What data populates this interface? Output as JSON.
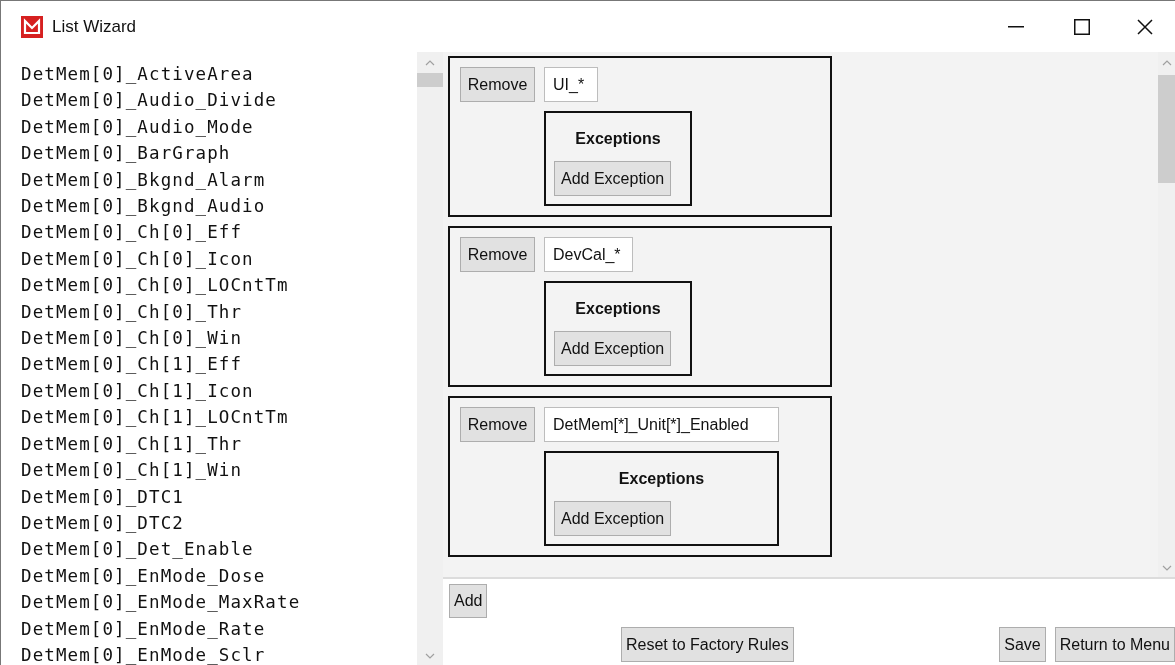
{
  "window": {
    "title": "List Wizard"
  },
  "variables": [
    "DetMem[0]_ActiveArea",
    "DetMem[0]_Audio_Divide",
    "DetMem[0]_Audio_Mode",
    "DetMem[0]_BarGraph",
    "DetMem[0]_Bkgnd_Alarm",
    "DetMem[0]_Bkgnd_Audio",
    "DetMem[0]_Ch[0]_Eff",
    "DetMem[0]_Ch[0]_Icon",
    "DetMem[0]_Ch[0]_LOCntTm",
    "DetMem[0]_Ch[0]_Thr",
    "DetMem[0]_Ch[0]_Win",
    "DetMem[0]_Ch[1]_Eff",
    "DetMem[0]_Ch[1]_Icon",
    "DetMem[0]_Ch[1]_LOCntTm",
    "DetMem[0]_Ch[1]_Thr",
    "DetMem[0]_Ch[1]_Win",
    "DetMem[0]_DTC1",
    "DetMem[0]_DTC2",
    "DetMem[0]_Det_Enable",
    "DetMem[0]_EnMode_Dose",
    "DetMem[0]_EnMode_MaxRate",
    "DetMem[0]_EnMode_Rate",
    "DetMem[0]_EnMode_Sclr"
  ],
  "rules": [
    {
      "remove_label": "Remove",
      "pattern": "UI_*",
      "exceptions_title": "Exceptions",
      "add_exception_label": "Add Exception"
    },
    {
      "remove_label": "Remove",
      "pattern": "DevCal_*",
      "exceptions_title": "Exceptions",
      "add_exception_label": "Add Exception"
    },
    {
      "remove_label": "Remove",
      "pattern": "DetMem[*]_Unit[*]_Enabled",
      "exceptions_title": "Exceptions",
      "add_exception_label": "Add Exception"
    }
  ],
  "add_label": "Add",
  "buttons": {
    "reset": "Reset to Factory Rules",
    "save": "Save",
    "return": "Return to Menu"
  }
}
